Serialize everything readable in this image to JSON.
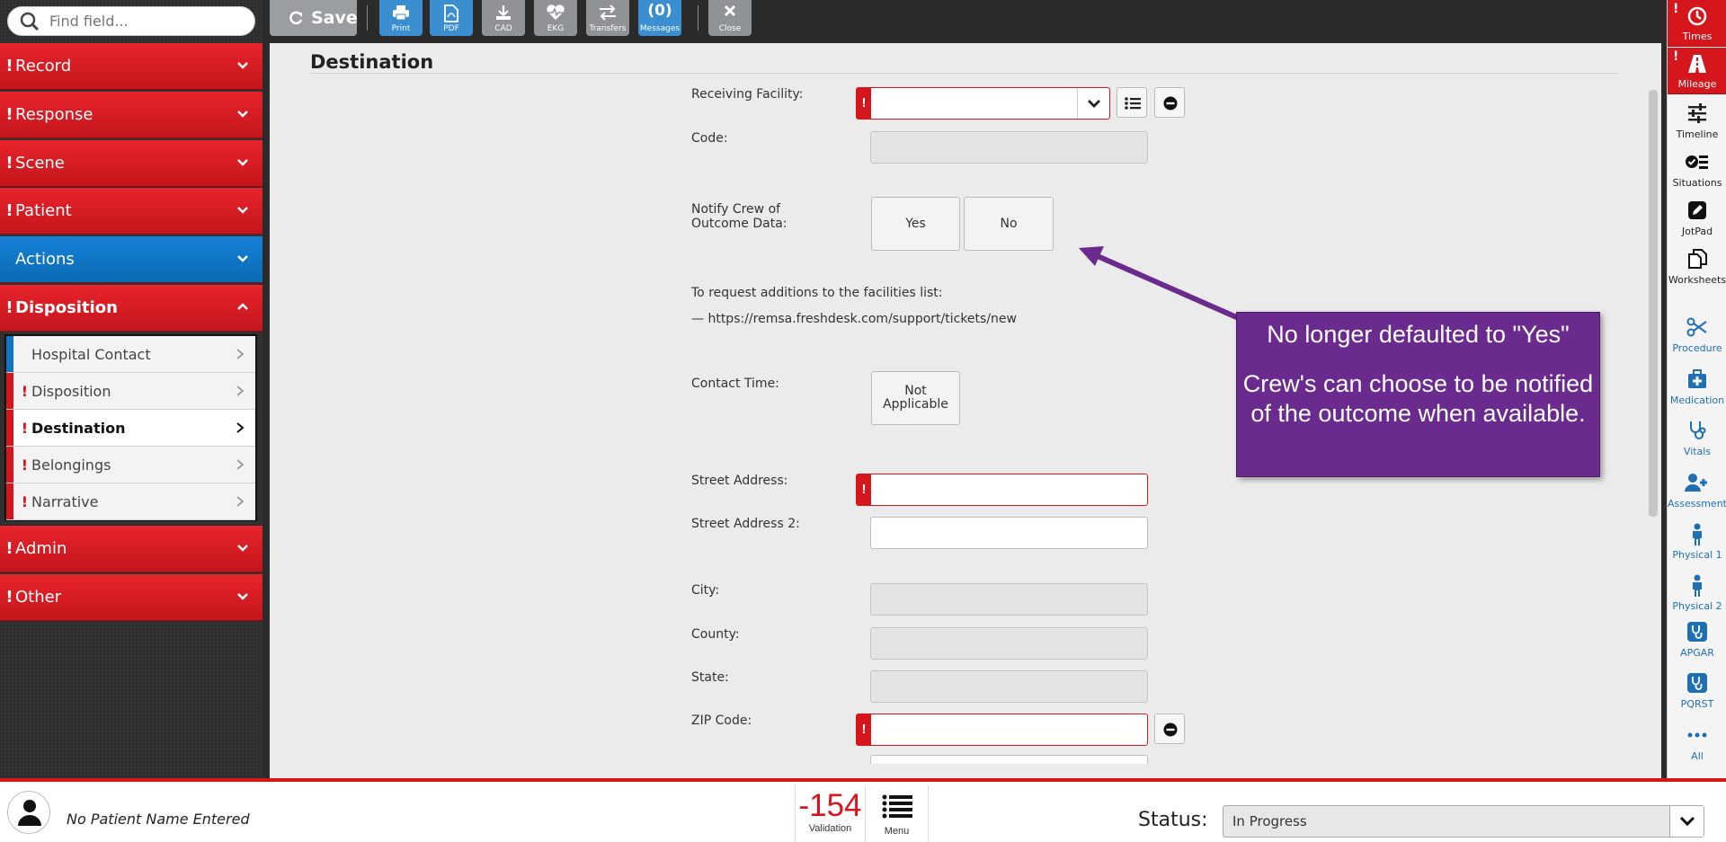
{
  "search": {
    "placeholder": "Find field..."
  },
  "sidebar": {
    "sections": [
      {
        "label": "Record",
        "flag": "!"
      },
      {
        "label": "Response",
        "flag": "!"
      },
      {
        "label": "Scene",
        "flag": "!"
      },
      {
        "label": "Patient",
        "flag": "!"
      },
      {
        "label": "Actions",
        "flag": ""
      },
      {
        "label": "Disposition",
        "flag": "!"
      },
      {
        "label": "Admin",
        "flag": "!"
      },
      {
        "label": "Other",
        "flag": "!"
      }
    ],
    "sub_items": [
      {
        "label": "Hospital Contact",
        "flag": ""
      },
      {
        "label": "Disposition",
        "flag": "!"
      },
      {
        "label": "Destination",
        "flag": "!"
      },
      {
        "label": "Belongings",
        "flag": "!"
      },
      {
        "label": "Narrative",
        "flag": "!"
      }
    ]
  },
  "toolbar": {
    "save_label": "Save",
    "print_label": "Print",
    "pdf_label": "PDF",
    "cad_label": "CAD",
    "ekg_label": "EKG",
    "transfers_label": "Transfers",
    "messages_count": "(0)",
    "messages_label": "Messages",
    "close_label": "Close"
  },
  "form": {
    "title": "Destination",
    "receiving_facility_label": "Receiving Facility:",
    "code_label": "Code:",
    "notify_label_1": "Notify Crew of",
    "notify_label_2": "Outcome Data:",
    "yes_label": "Yes",
    "no_label": "No",
    "request_text": "To request additions to the facilities list:",
    "request_link": "— https://remsa.freshdesk.com/support/tickets/new",
    "contact_time_label": "Contact Time:",
    "not_applicable_1": "Not",
    "not_applicable_2": "Applicable",
    "street_address_label": "Street Address:",
    "street_address_2_label": "Street Address 2:",
    "city_label": "City:",
    "county_label": "County:",
    "state_label": "State:",
    "zip_label": "ZIP Code:",
    "required_flag": "!"
  },
  "callout": {
    "line1": "No longer defaulted to \"Yes\"",
    "line2": "Crew's can choose to be notified of the outcome when available.",
    "color": "#6b2a8e"
  },
  "rightbar": {
    "items": [
      {
        "label": "Times",
        "icon": "clock-icon"
      },
      {
        "label": "Mileage",
        "icon": "road-icon"
      },
      {
        "label": "Timeline",
        "icon": "sliders-icon"
      },
      {
        "label": "Situations",
        "icon": "checklist-icon"
      },
      {
        "label": "JotPad",
        "icon": "pencil-icon"
      },
      {
        "label": "Worksheets",
        "icon": "documents-icon"
      },
      {
        "label": "Procedure",
        "icon": "scissors-icon"
      },
      {
        "label": "Medication",
        "icon": "medkit-icon"
      },
      {
        "label": "Vitals",
        "icon": "stethoscope-icon"
      },
      {
        "label": "Assessment",
        "icon": "user-plus-icon"
      },
      {
        "label": "Physical 1",
        "icon": "person-icon"
      },
      {
        "label": "Physical 2",
        "icon": "person-icon"
      },
      {
        "label": "APGAR",
        "icon": "stethoscope-icon"
      },
      {
        "label": "PQRST",
        "icon": "stethoscope-icon"
      },
      {
        "label": "All",
        "icon": "ellipsis-icon"
      }
    ]
  },
  "bottombar": {
    "patient_name": "No Patient Name Entered",
    "validation_count": "-154",
    "validation_label": "Validation",
    "menu_label": "Menu",
    "status_label": "Status:",
    "status_value": "In Progress"
  },
  "colors": {
    "alert_red": "#d6161d",
    "action_blue": "#0f74c4",
    "callout_purple": "#6b2a8e"
  }
}
